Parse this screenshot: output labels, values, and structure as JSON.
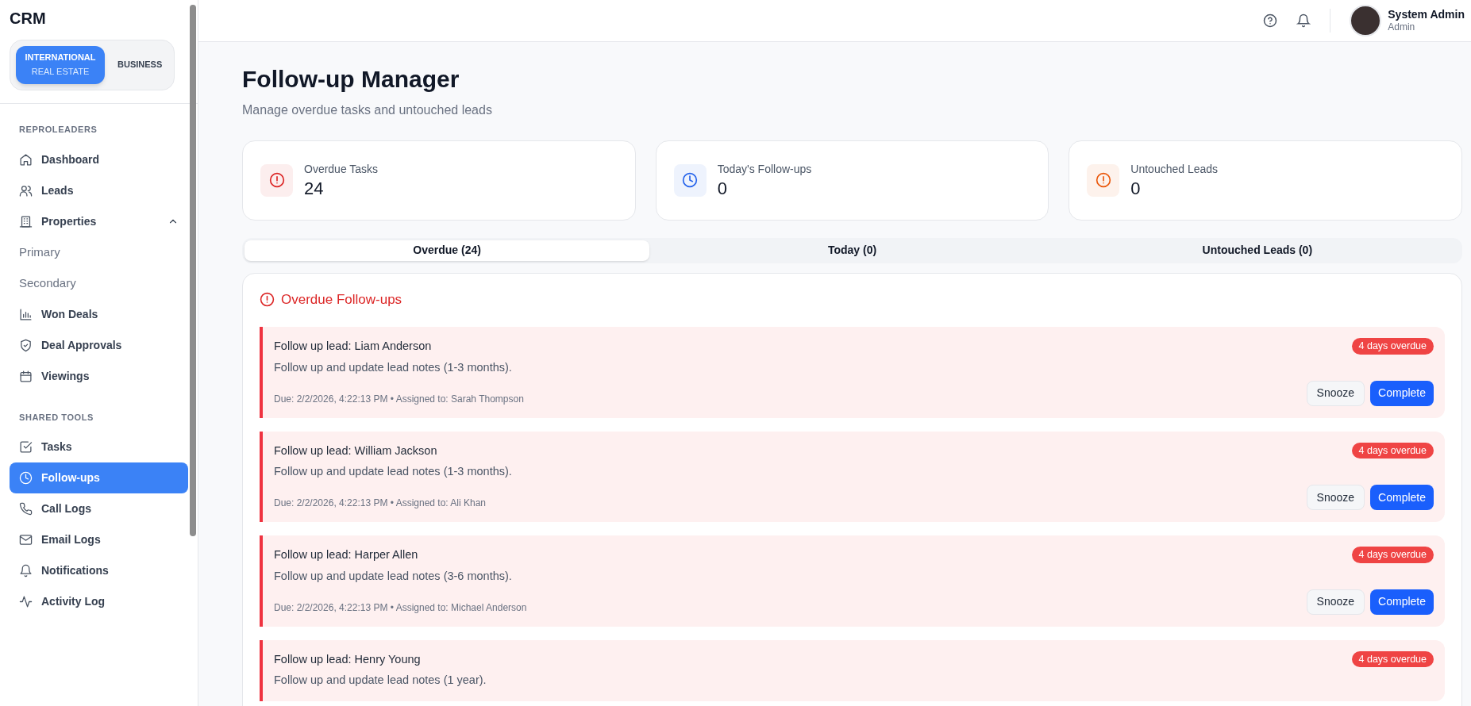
{
  "brand": "CRM",
  "workspace_switch": [
    {
      "label": "INTERNATIONAL",
      "sublabel": "REAL ESTATE",
      "selected": true
    },
    {
      "label": "BUSINESS",
      "selected": false
    }
  ],
  "sidebar": {
    "sections": [
      {
        "title": "REPROLEADERS",
        "items": [
          {
            "kind": "item",
            "label": "Dashboard",
            "selected": false
          },
          {
            "kind": "item",
            "label": "Leads",
            "selected": false
          },
          {
            "kind": "group",
            "label": "Properties",
            "selected": false,
            "expanded": true,
            "children": [
              {
                "label": "Primary"
              },
              {
                "label": "Secondary"
              }
            ]
          },
          {
            "kind": "item",
            "label": "Won Deals",
            "selected": false
          },
          {
            "kind": "item",
            "label": "Deal Approvals",
            "selected": false
          },
          {
            "kind": "item",
            "label": "Viewings",
            "selected": false
          }
        ]
      },
      {
        "title": "SHARED TOOLS",
        "items": [
          {
            "kind": "item",
            "label": "Tasks",
            "selected": false
          },
          {
            "kind": "item",
            "label": "Follow-ups",
            "selected": true
          },
          {
            "kind": "item",
            "label": "Call Logs",
            "selected": false
          },
          {
            "kind": "item",
            "label": "Email Logs",
            "selected": false
          },
          {
            "kind": "item",
            "label": "Notifications",
            "selected": false
          },
          {
            "kind": "item",
            "label": "Activity Log",
            "selected": false
          }
        ]
      }
    ]
  },
  "user": {
    "name": "System Admin",
    "role": "Admin"
  },
  "page": {
    "title": "Follow-up Manager",
    "subtitle": "Manage overdue tasks and untouched leads"
  },
  "stats": [
    {
      "label": "Overdue Tasks",
      "value": "24",
      "color": "#dc2626"
    },
    {
      "label": "Today's Follow-ups",
      "value": "0",
      "color": "#2563eb"
    },
    {
      "label": "Untouched Leads",
      "value": "0",
      "color": "#ea580c"
    }
  ],
  "tabs": [
    {
      "label": "Overdue (24)",
      "selected": true
    },
    {
      "label": "Today (0)",
      "selected": false
    },
    {
      "label": "Untouched Leads (0)",
      "selected": false
    }
  ],
  "panel": {
    "title": "Overdue Follow-ups",
    "items": [
      {
        "title": "Follow up lead: Liam Anderson",
        "description": "Follow up and update lead notes (1-3 months).",
        "meta": "Due: 2/2/2026, 4:22:13 PM • Assigned to: Sarah Thompson",
        "badge": "4 days overdue",
        "actions": [
          "Snooze",
          "Complete"
        ]
      },
      {
        "title": "Follow up lead: William Jackson",
        "description": "Follow up and update lead notes (1-3 months).",
        "meta": "Due: 2/2/2026, 4:22:13 PM • Assigned to: Ali Khan",
        "badge": "4 days overdue",
        "actions": [
          "Snooze",
          "Complete"
        ]
      },
      {
        "title": "Follow up lead: Harper Allen",
        "description": "Follow up and update lead notes (3-6 months).",
        "meta": "Due: 2/2/2026, 4:22:13 PM • Assigned to: Michael Anderson",
        "badge": "4 days overdue",
        "actions": [
          "Snooze",
          "Complete"
        ]
      },
      {
        "title": "Follow up lead: Henry Young",
        "description": "Follow up and update lead notes (1 year).",
        "badge": "4 days overdue"
      }
    ]
  }
}
